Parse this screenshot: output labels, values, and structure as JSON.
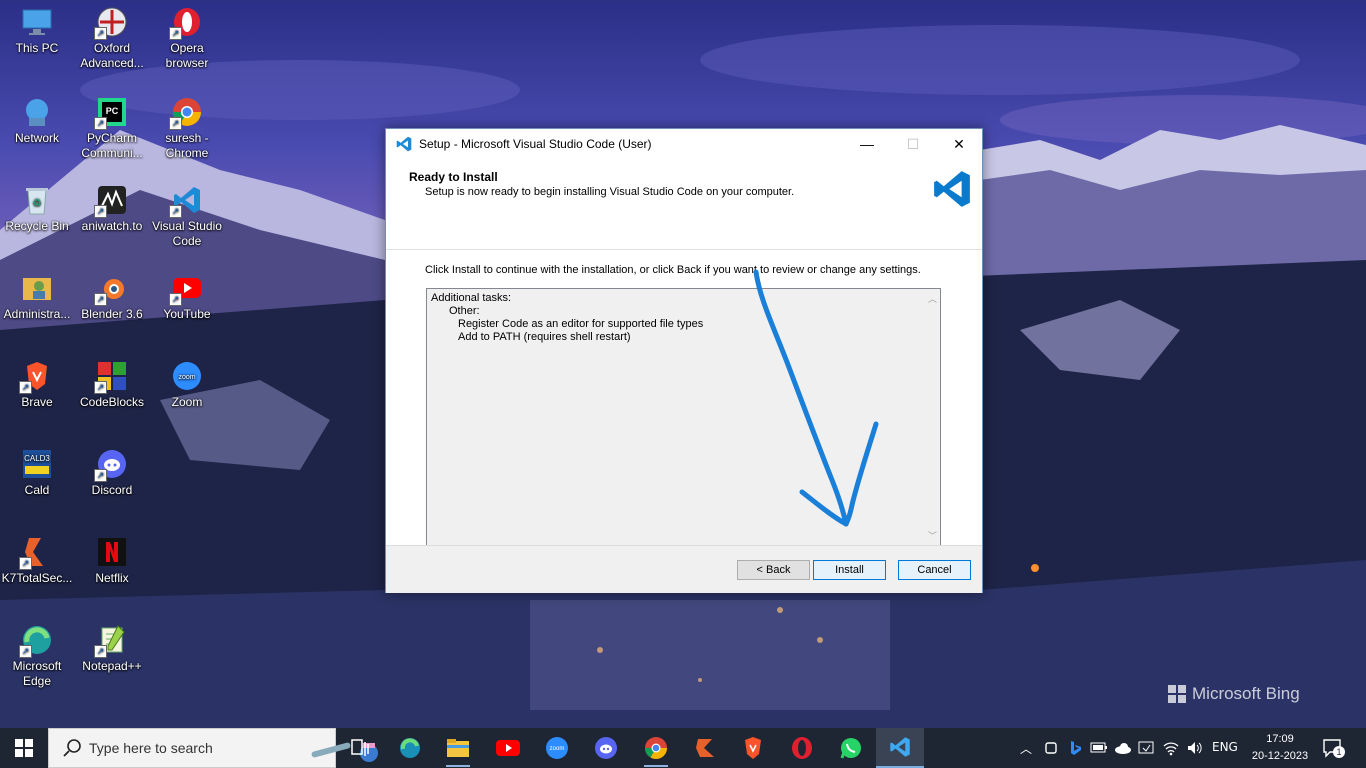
{
  "desktop": {
    "icons": [
      {
        "label": "This PC"
      },
      {
        "label": "Oxford Advanced..."
      },
      {
        "label": "Opera browser"
      },
      {
        "label": "Network"
      },
      {
        "label": "PyCharm Communi..."
      },
      {
        "label": "suresh - Chrome"
      },
      {
        "label": "Recycle Bin"
      },
      {
        "label": "aniwatch.to"
      },
      {
        "label": "Visual Studio Code"
      },
      {
        "label": "Administra..."
      },
      {
        "label": "Blender 3.6"
      },
      {
        "label": "YouTube"
      },
      {
        "label": "Brave"
      },
      {
        "label": "CodeBlocks"
      },
      {
        "label": "Zoom"
      },
      {
        "label": "Cald"
      },
      {
        "label": "Discord"
      },
      {
        "label": "K7TotalSec..."
      },
      {
        "label": "Netflix"
      },
      {
        "label": "Microsoft Edge"
      },
      {
        "label": "Notepad++"
      }
    ],
    "watermark": "Microsoft Bing"
  },
  "dialog": {
    "title": "Setup - Microsoft Visual Studio Code (User)",
    "heading": "Ready to Install",
    "subheading": "Setup is now ready to begin installing Visual Studio Code on your computer.",
    "intro": "Click Install to continue with the installation, or click Back if you want to review or change any settings.",
    "memo": {
      "line1": "Additional tasks:",
      "line2": "Other:",
      "line3": "Register Code as an editor for supported file types",
      "line4": "Add to PATH (requires shell restart)"
    },
    "buttons": {
      "back": "< Back",
      "install": "Install",
      "cancel": "Cancel"
    },
    "window_controls": {
      "minimize": "—",
      "maximize": "☐",
      "close": "✕"
    }
  },
  "taskbar": {
    "search_placeholder": "Type here to search",
    "pinned": [
      "task-view",
      "edge",
      "file-explorer",
      "youtube",
      "zoom",
      "discord",
      "chrome",
      "k7",
      "brave",
      "opera",
      "whatsapp",
      "vscode"
    ],
    "active": "vscode",
    "tray": {
      "language": "ENG",
      "time": "17:09",
      "date": "20-12-2023",
      "notifications": "1"
    }
  },
  "colors": {
    "vscode_blue": "#0a7acc",
    "annotation_arrow": "#1a7fd8",
    "taskbar": "#1f2633"
  }
}
